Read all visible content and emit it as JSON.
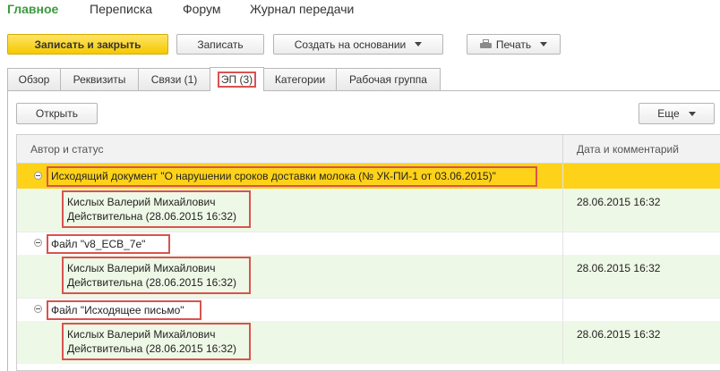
{
  "nav": {
    "main": "Главное",
    "correspondence": "Переписка",
    "forum": "Форум",
    "log": "Журнал передачи"
  },
  "toolbar": {
    "save_close": "Записать и закрыть",
    "save": "Записать",
    "create_based": "Создать на основании",
    "print": "Печать"
  },
  "tabs": [
    "Обзор",
    "Реквизиты",
    "Связи (1)",
    "ЭП (3)",
    "Категории",
    "Рабочая группа"
  ],
  "panel": {
    "open": "Открыть",
    "more": "Еще"
  },
  "table": {
    "headers": {
      "author": "Автор и статус",
      "date": "Дата и комментарий"
    },
    "groups": [
      {
        "title": "Исходящий документ \"О нарушении сроков доставки молока (№ УК-ПИ-1 от 03.06.2015)\"",
        "signer": "Кислых Валерий Михайлович",
        "status": "Действительна (28.06.2015 16:32)",
        "date": "28.06.2015 16:32"
      },
      {
        "title": "Файл \"v8_ECB_7e\"",
        "signer": "Кислых Валерий Михайлович",
        "status": "Действительна (28.06.2015 16:32)",
        "date": "28.06.2015 16:32"
      },
      {
        "title": "Файл \"Исходящее письмо\"",
        "signer": "Кислых Валерий Михайлович",
        "status": "Действительна (28.06.2015 16:32)",
        "date": "28.06.2015 16:32"
      }
    ]
  },
  "colors": {
    "accent_green": "#3c9a3c",
    "selected_row": "#ffd21a",
    "signature_row": "#eef8e6",
    "highlight_box": "#d9534f"
  }
}
